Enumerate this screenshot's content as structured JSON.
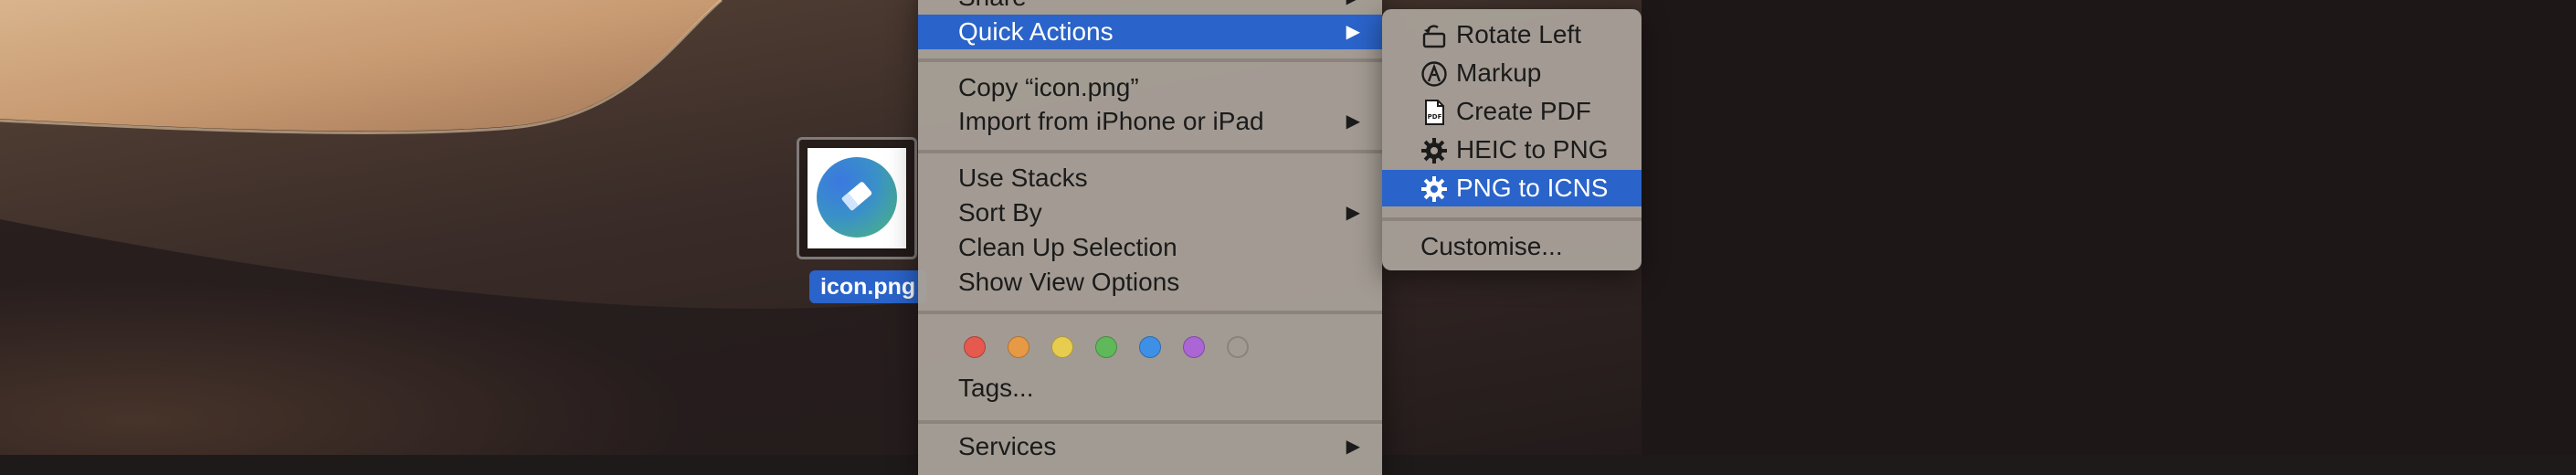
{
  "desktop_file": {
    "name": "icon.png"
  },
  "context_menu": {
    "items": [
      {
        "label": "Share",
        "has_submenu": true
      },
      {
        "label": "Quick Actions",
        "has_submenu": true,
        "highlighted": true
      },
      {
        "label": "Copy “icon.png”"
      },
      {
        "label": "Import from iPhone or iPad",
        "has_submenu": true
      },
      {
        "label": "Use Stacks"
      },
      {
        "label": "Sort By",
        "has_submenu": true
      },
      {
        "label": "Clean Up Selection"
      },
      {
        "label": "Show View Options"
      },
      {
        "label": "Tags..."
      },
      {
        "label": "Services",
        "has_submenu": true
      }
    ],
    "tag_colors": [
      "#e5594e",
      "#e79a45",
      "#e8cc4f",
      "#5fb95a",
      "#3e8fe6",
      "#ac65d5",
      "#9b9590"
    ],
    "tag_names": [
      "Red",
      "Orange",
      "Yellow",
      "Green",
      "Blue",
      "Purple",
      "Gray"
    ]
  },
  "quick_actions_submenu": {
    "items": [
      {
        "label": "Rotate Left",
        "icon": "rotate-left-icon"
      },
      {
        "label": "Markup",
        "icon": "markup-icon"
      },
      {
        "label": "Create PDF",
        "icon": "pdf-document-icon"
      },
      {
        "label": "HEIC to PNG",
        "icon": "gear-icon"
      },
      {
        "label": "PNG to ICNS",
        "icon": "gear-icon",
        "highlighted": true
      },
      {
        "label": "Customise..."
      }
    ]
  },
  "colors": {
    "highlight": "#2a63c9",
    "menu_bg": "#a8a098"
  }
}
